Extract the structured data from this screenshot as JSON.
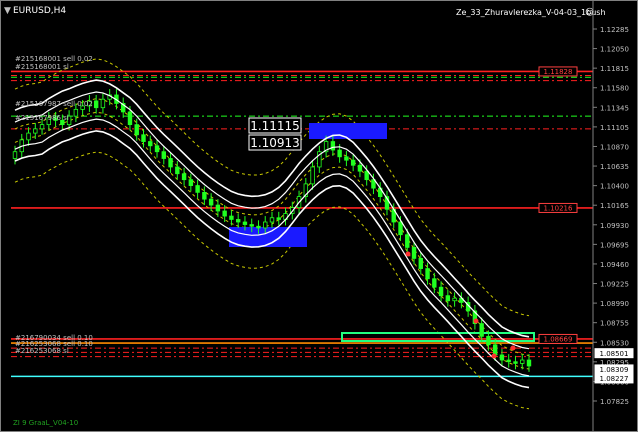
{
  "window": {
    "symbol_label": "EURUSD,H4",
    "indicator_label": "Ze_33_Zhuravlerezka_V-04-03_1bush",
    "footer_label": "ZI 9 GraaL_V04-10"
  },
  "price_axis": {
    "ticks": [
      "1.12285",
      "1.12050",
      "1.11815",
      "1.11580",
      "1.11345",
      "1.11105",
      "1.10870",
      "1.10635",
      "1.10400",
      "1.10165",
      "1.09930",
      "1.09695",
      "1.09460",
      "1.09225",
      "1.08990",
      "1.08755",
      "1.08530",
      "1.08295",
      "1.08060",
      "1.07825"
    ],
    "badges": [
      {
        "text": "1.11828",
        "price": 1.11828,
        "color": "#ff4040",
        "style": "outline"
      },
      {
        "text": "1.10216",
        "price": 1.10216,
        "color": "#ff4040",
        "style": "outline"
      },
      {
        "text": "1.08669",
        "price": 1.08669,
        "color": "#ff4040",
        "style": "outline"
      },
      {
        "text": "1.08501",
        "price": 1.08501,
        "color": "#ffffff",
        "style": "filled"
      },
      {
        "text": "1.08309",
        "price": 1.08309,
        "color": "#ffffff",
        "style": "filled"
      },
      {
        "text": "1.08227",
        "price": 1.08227,
        "color": "#ffffff",
        "style": "filled"
      }
    ]
  },
  "order_labels": [
    "#215168001 sell 0.02",
    "#215168001 sl",
    "#215167987 sell 0.02",
    "#215167986 sl",
    "#216790034 sell 0.10",
    "#216253068 sell 0.10",
    "#216253068 sl"
  ],
  "price_boxes": {
    "upper": "1.11115",
    "lower": "1.10913"
  },
  "chart_data": {
    "type": "candlestick",
    "symbol": "EURUSD",
    "timeframe": "H4",
    "y_range": [
      1.077,
      1.124
    ],
    "horizontal_levels": [
      {
        "price": 1.11828,
        "color": "#ff2020",
        "style": "solid"
      },
      {
        "price": 1.1178,
        "color": "#ff2020",
        "style": "dashdot"
      },
      {
        "price": 1.1172,
        "color": "#ff2020",
        "style": "dashdot"
      },
      {
        "price": 1.1176,
        "color": "#20ff20",
        "style": "dashdot"
      },
      {
        "price": 1.113,
        "color": "#20ff20",
        "style": "dashdot"
      },
      {
        "price": 1.1115,
        "color": "#ff2020",
        "style": "dashdot"
      },
      {
        "price": 1.10216,
        "color": "#ff2020",
        "style": "solid"
      },
      {
        "price": 1.08669,
        "color": "#ff2020",
        "style": "solid"
      },
      {
        "price": 1.0862,
        "color": "#ff8a00",
        "style": "solid"
      },
      {
        "price": 1.0856,
        "color": "#ff2020",
        "style": "dashdot"
      },
      {
        "price": 1.0851,
        "color": "#ff2020",
        "style": "dashdot"
      },
      {
        "price": 1.0846,
        "color": "#ff2020",
        "style": "dashdot"
      },
      {
        "price": 1.08227,
        "color": "#40ffff",
        "style": "solid"
      }
    ],
    "closes": [
      1.1088,
      1.1102,
      1.111,
      1.1115,
      1.112,
      1.1128,
      1.1125,
      1.112,
      1.113,
      1.1138,
      1.1142,
      1.1148,
      1.114,
      1.115,
      1.1155,
      1.1145,
      1.1135,
      1.112,
      1.1108,
      1.11,
      1.1095,
      1.1088,
      1.108,
      1.107,
      1.1062,
      1.1055,
      1.1048,
      1.104,
      1.1032,
      1.1025,
      1.1018,
      1.1012,
      1.1008,
      1.1005,
      1.1002,
      1.1,
      1.0998,
      1.1005,
      1.101,
      1.1008,
      1.1015,
      1.1022,
      1.1035,
      1.105,
      1.107,
      1.1088,
      1.11,
      1.109,
      1.1082,
      1.1078,
      1.1072,
      1.1065,
      1.1055,
      1.1045,
      1.1035,
      1.102,
      1.1005,
      1.099,
      1.0975,
      1.0962,
      1.095,
      1.0938,
      1.0928,
      1.0918,
      1.0912,
      1.0915,
      1.091,
      1.09,
      1.0885,
      1.087,
      1.086,
      1.0848,
      1.0842,
      1.084,
      1.0838,
      1.0842,
      1.0835
    ]
  },
  "colors": {
    "background": "#000000",
    "bull_candle": "#20ff20",
    "bear_candle": "#20ff20",
    "band_outer": "#ffffff",
    "band_dotted": "#c8c800",
    "highlight_box": "#1a1aff",
    "green_rect": "#20ff80"
  }
}
